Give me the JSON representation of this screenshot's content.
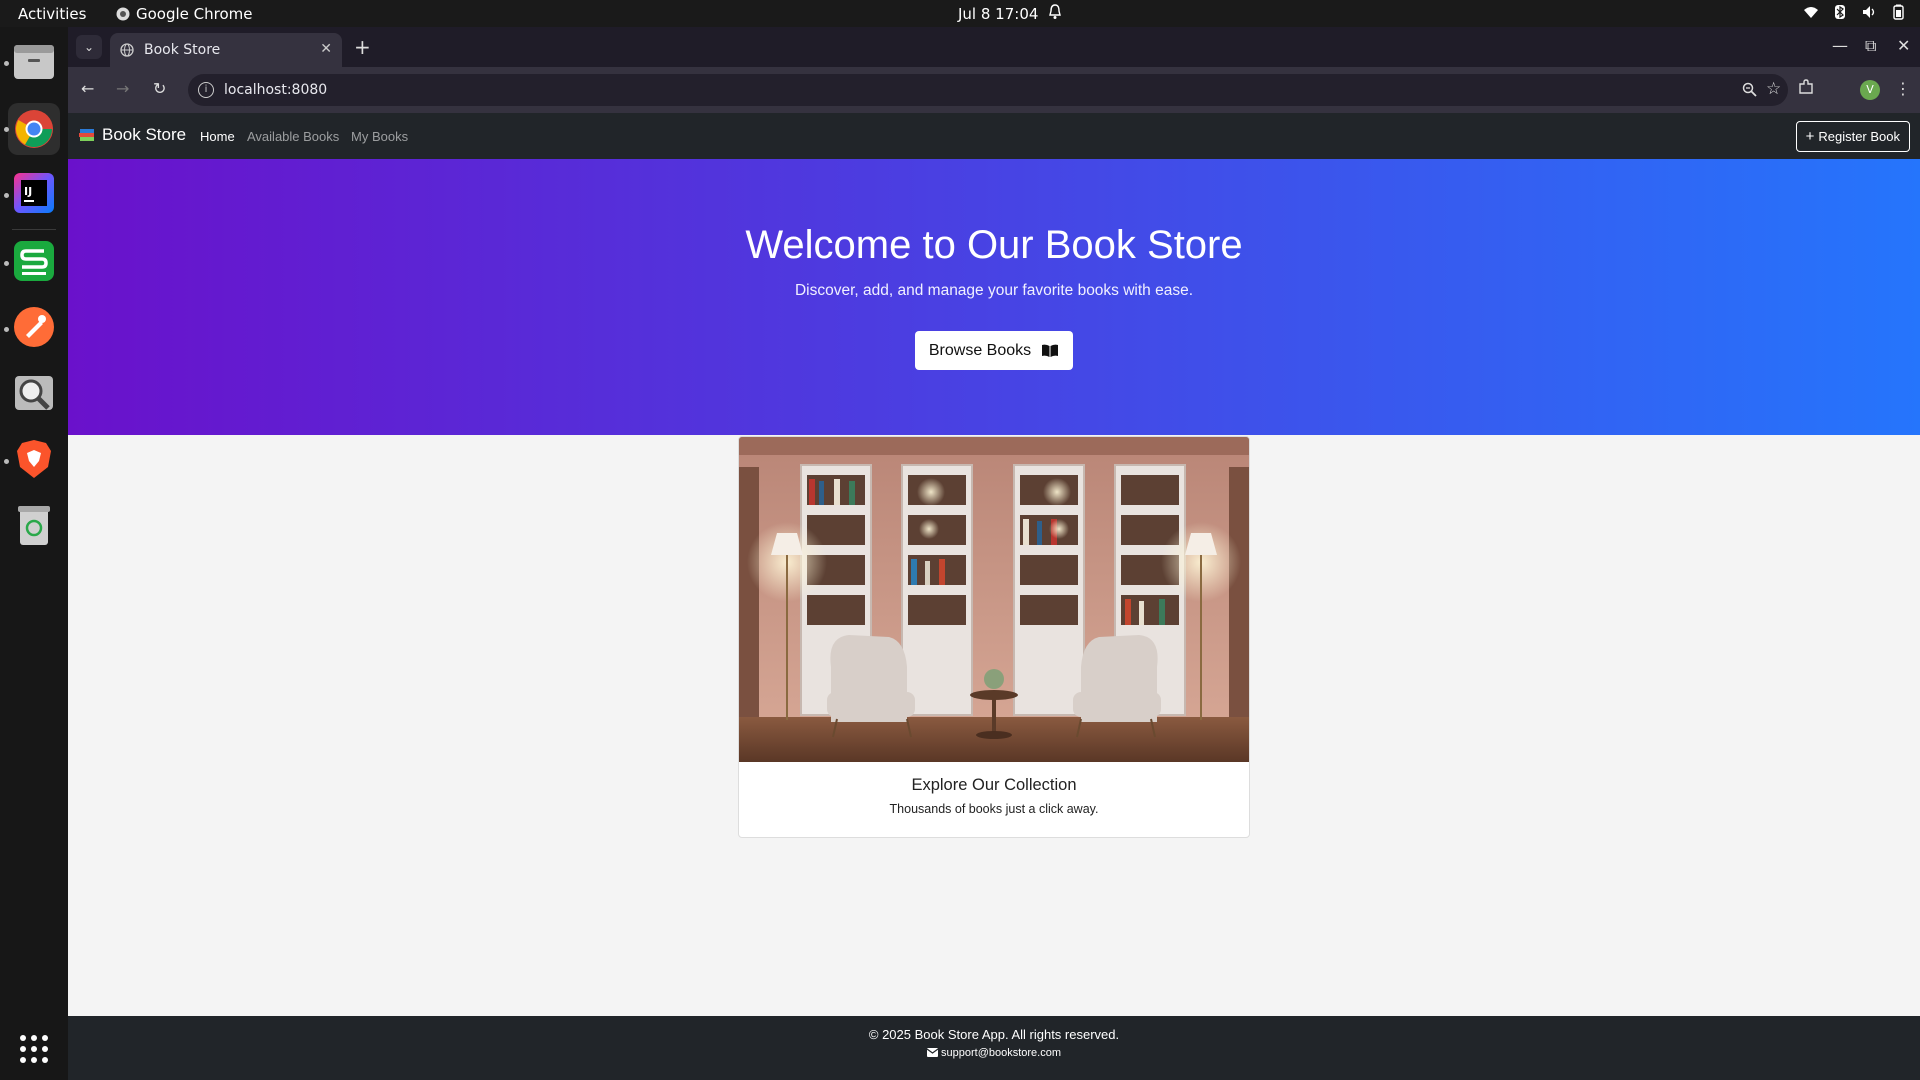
{
  "system": {
    "activities": "Activities",
    "app_name": "Google Chrome",
    "clock": "Jul 8  17:04"
  },
  "browser": {
    "tab_title": "Book Store",
    "url": "localhost:8080",
    "profile_initial": "V"
  },
  "site": {
    "brand": "Book Store",
    "nav": {
      "home": "Home",
      "available": "Available Books",
      "mine": "My Books"
    },
    "register_label": "Register Book",
    "hero": {
      "title": "Welcome to Our Book Store",
      "subtitle": "Discover, add, and manage your favorite books with ease.",
      "button": "Browse Books"
    },
    "card": {
      "title": "Explore Our Collection",
      "text": "Thousands of books just a click away."
    },
    "footer": {
      "copyright": "© 2025 Book Store App. All rights reserved.",
      "email": "support@bookstore.com"
    }
  },
  "colors": {
    "hero_start": "#6a11cb",
    "hero_end": "#2575fc",
    "navbar": "#212529"
  }
}
